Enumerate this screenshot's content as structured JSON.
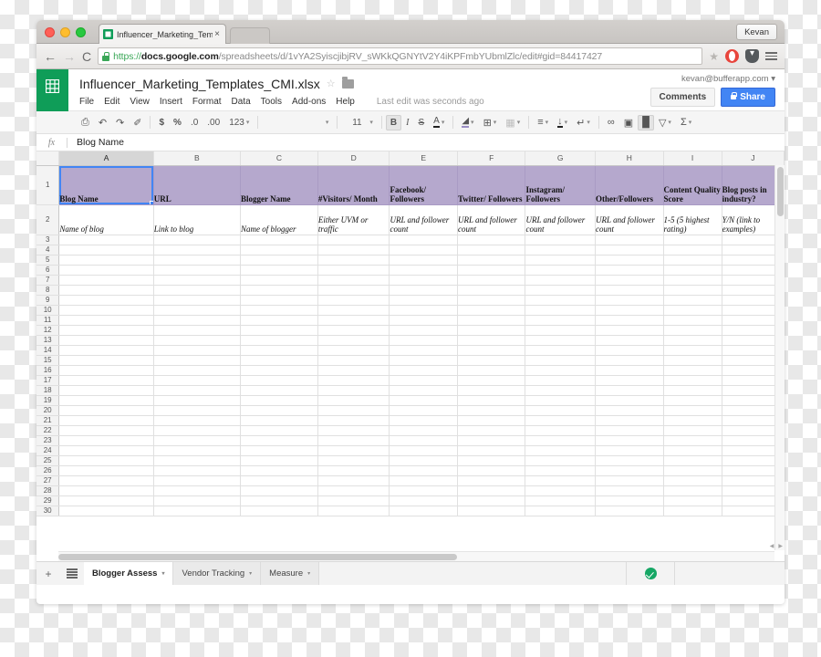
{
  "browser": {
    "profile_label": "Kevan",
    "tab": {
      "title": "Influencer_Marketing_Temp",
      "close_label": "×"
    },
    "nav": {
      "back": "←",
      "forward": "→",
      "reload": "C"
    },
    "url": {
      "scheme": "https://",
      "host": "docs.google.com",
      "path": "/spreadsheets/d/1vYA2SyiscjibjRV_sWKkQGNYtV2Y4iKPFmbYUbmlZlc/edit#gid=84417427",
      "full": "https://docs.google.com/spreadsheets/d/1vYA2SyiscjibjRV_sWKkQGNYtV2Y4iKPFmbYUbmlZlc/edit#gid=84417427"
    },
    "star_icon": "★"
  },
  "docheader": {
    "title": "Influencer_Marketing_Templates_CMI.xlsx",
    "star_icon": "☆",
    "menus": [
      "File",
      "Edit",
      "View",
      "Insert",
      "Format",
      "Data",
      "Tools",
      "Add-ons",
      "Help"
    ],
    "last_edit": "Last edit was seconds ago",
    "account": "kevan@bufferapp.com",
    "account_caret": "▾",
    "comments_label": "Comments",
    "share_label": "Share"
  },
  "toolbar": {
    "print": "⎙",
    "undo": "↶",
    "redo": "↷",
    "paint": "✐",
    "currency": "$",
    "percent": "%",
    "dec_decrease": ".0",
    "dec_increase": ".00",
    "more_formats": "123",
    "font_family": "",
    "font_size": "11",
    "bold": "B",
    "italic": "I",
    "strikethrough": "S",
    "text_color": "A",
    "fill_color": "◢",
    "borders": "⊞",
    "merge": "▦",
    "halign": "≡",
    "valign": "↓",
    "wrap": "↵",
    "link": "∞",
    "comment": "▣",
    "chart": "█",
    "filter": "▽",
    "functions": "Σ",
    "caret": "▾"
  },
  "formulabar": {
    "fx_label": "fx",
    "value": "Blog Name"
  },
  "grid": {
    "columns": [
      "A",
      "B",
      "C",
      "D",
      "E",
      "F",
      "G",
      "H",
      "I",
      "J"
    ],
    "active_column": "A",
    "selected_cell": "A1",
    "rows": [
      "1",
      "2",
      "3",
      "4",
      "5",
      "6",
      "7",
      "8",
      "9",
      "10",
      "11",
      "12",
      "13",
      "14",
      "15",
      "16",
      "17",
      "18",
      "19",
      "20",
      "21",
      "22",
      "23",
      "24",
      "25",
      "26",
      "27",
      "28",
      "29",
      "30"
    ],
    "header_fill": "#b5a8cd",
    "header_row": [
      "Blog Name",
      "URL",
      "Blogger Name",
      "#Visitors/ Month",
      "Facebook/ Followers",
      "Twitter/ Followers",
      "Instagram/ Followers",
      "Other/Followers",
      "Content Quality Score",
      "Blog posts in industry?"
    ],
    "description_row": [
      "Name of blog",
      "Link to blog",
      "Name of blogger",
      "Either UVM or traffic",
      "URL and follower count",
      "URL and follower count",
      "URL and follower count",
      "URL and follower count",
      "1-5 (5 highest rating)",
      "Y/N (link to examples)"
    ]
  },
  "sheetbar": {
    "add_label": "+",
    "all_sheets_label": "☰",
    "tabs": [
      {
        "label": "Blogger Assess",
        "active": true
      },
      {
        "label": "Vendor Tracking",
        "active": false
      },
      {
        "label": "Measure",
        "active": false
      }
    ],
    "caret": "▾",
    "saved_status": "All changes saved in Drive"
  }
}
